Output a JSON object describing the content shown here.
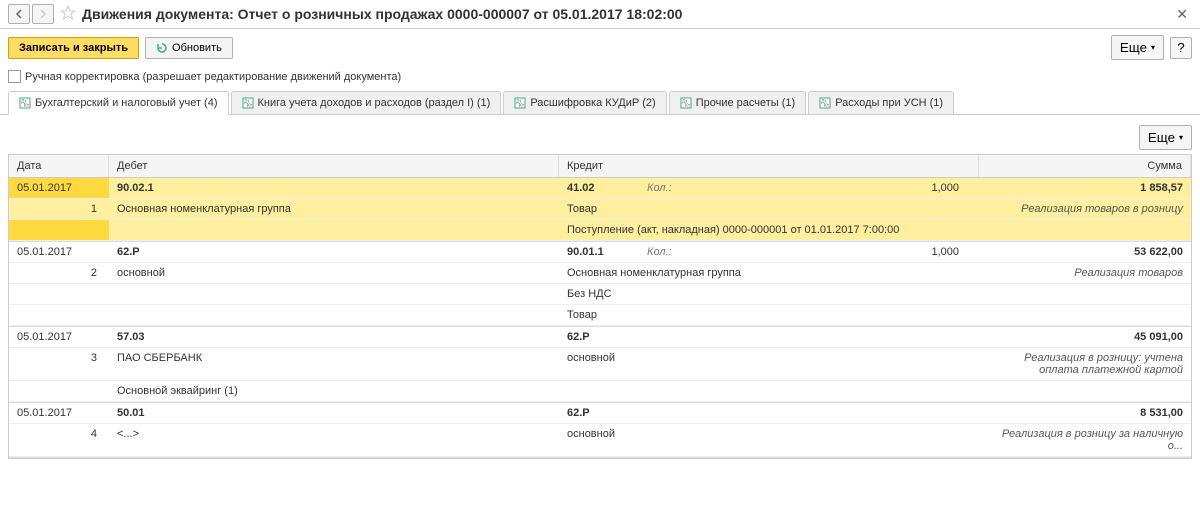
{
  "header": {
    "title": "Движения документа: Отчет о розничных продажах 0000-000007 от 05.01.2017 18:02:00"
  },
  "toolbar": {
    "save_close": "Записать и закрыть",
    "refresh": "Обновить",
    "more": "Еще",
    "help": "?"
  },
  "manual": {
    "label": "Ручная корректировка (разрешает редактирование движений документа)"
  },
  "tabs": [
    {
      "label": "Бухгалтерский и налоговый учет (4)",
      "active": true
    },
    {
      "label": "Книга учета доходов и расходов (раздел I) (1)"
    },
    {
      "label": "Расшифровка КУДиР (2)"
    },
    {
      "label": "Прочие расчеты (1)"
    },
    {
      "label": "Расходы при УСН (1)"
    }
  ],
  "grid": {
    "headers": {
      "date": "Дата",
      "debit": "Дебет",
      "credit": "Кредит",
      "sum": "Сумма"
    },
    "entries": [
      {
        "highlight": true,
        "date": "05.01.2017",
        "num": "1",
        "debit_acc": "90.02.1",
        "debit_lines": [
          "Основная номенклатурная группа"
        ],
        "credit_acc": "41.02",
        "credit_kol_label": "Кол.:",
        "credit_kol_val": "1,000",
        "credit_lines": [
          "Товар",
          "Поступление (акт, накладная) 0000-000001 от 01.01.2017 7:00:00"
        ],
        "sum": "1 858,57",
        "sum_desc": "Реализация товаров в розницу"
      },
      {
        "date": "05.01.2017",
        "num": "2",
        "debit_acc": "62.Р",
        "debit_lines": [
          "основной"
        ],
        "credit_acc": "90.01.1",
        "credit_kol_label": "Кол.:",
        "credit_kol_val": "1,000",
        "credit_lines": [
          "Основная номенклатурная группа",
          "Без НДС",
          "Товар"
        ],
        "sum": "53 622,00",
        "sum_desc": "Реализация товаров"
      },
      {
        "date": "05.01.2017",
        "num": "3",
        "debit_acc": "57.03",
        "debit_lines": [
          "ПАО СБЕРБАНК",
          "Основной эквайринг (1)"
        ],
        "credit_acc": "62.Р",
        "credit_lines": [
          "основной"
        ],
        "sum": "45 091,00",
        "sum_desc": "Реализация в розницу: учтена оплата платежной картой"
      },
      {
        "date": "05.01.2017",
        "num": "4",
        "debit_acc": "50.01",
        "debit_lines": [
          "<...>"
        ],
        "credit_acc": "62.Р",
        "credit_lines": [
          "основной"
        ],
        "sum": "8 531,00",
        "sum_desc": "Реализация в розницу за наличную о..."
      }
    ]
  }
}
